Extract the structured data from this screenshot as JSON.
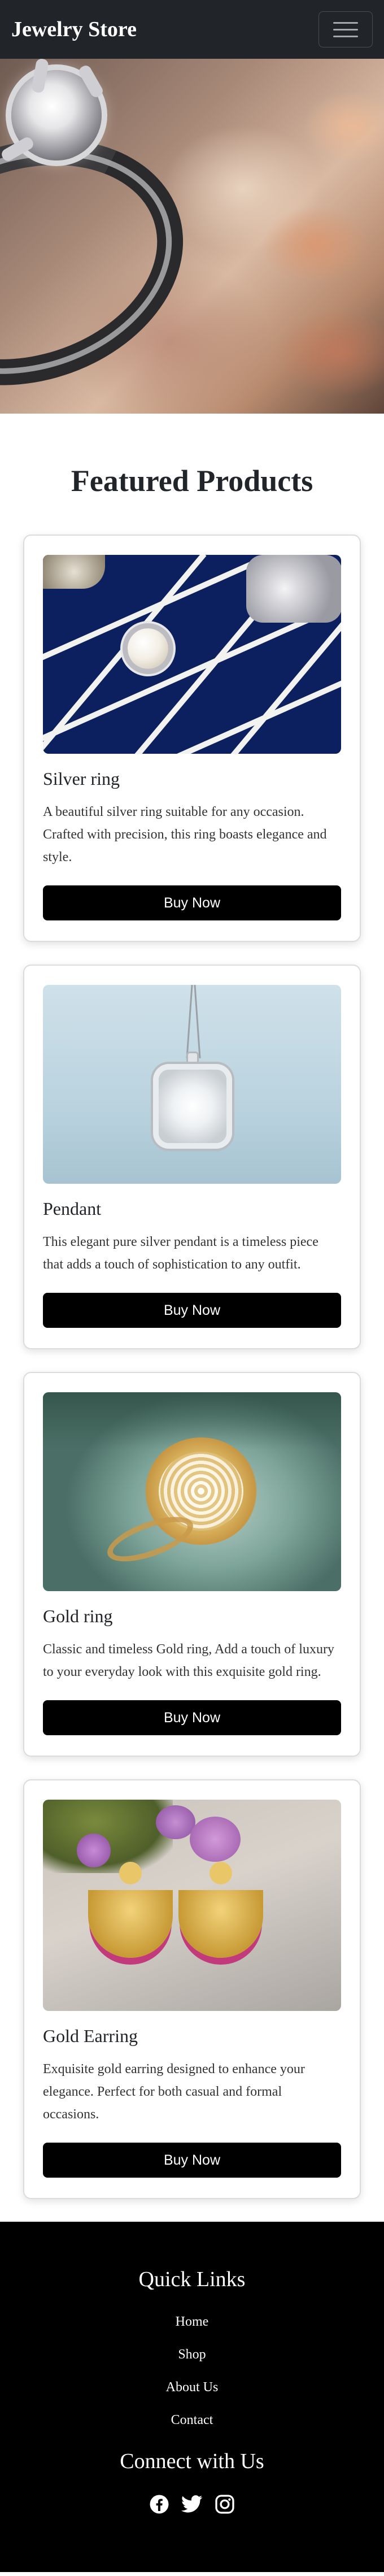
{
  "navbar": {
    "brand": "Jewelry Store",
    "toggler_icon": "hamburger-menu-icon"
  },
  "main": {
    "section_title": "Featured Products"
  },
  "products": [
    {
      "title": "Silver ring",
      "description": "A beautiful silver ring suitable for any occasion. Crafted with precision, this ring boasts elegance and style.",
      "button_label": "Buy Now"
    },
    {
      "title": "Pendant",
      "description": "This elegant pure silver pendant is a timeless piece that adds a touch of sophistication to any outfit.",
      "button_label": "Buy Now"
    },
    {
      "title": "Gold ring",
      "description": "Classic and timeless Gold ring, Add a touch of luxury to your everyday look with this exquisite gold ring.",
      "button_label": "Buy Now"
    },
    {
      "title": "Gold Earring",
      "description": "Exquisite gold earring designed to enhance your elegance. Perfect for both casual and formal occasions.",
      "button_label": "Buy Now"
    }
  ],
  "footer": {
    "quick_links_title": "Quick Links",
    "links": [
      "Home",
      "Shop",
      "About Us",
      "Contact"
    ],
    "connect_title": "Connect with Us",
    "social_icons": [
      "facebook-icon",
      "twitter-icon",
      "instagram-icon"
    ]
  },
  "colors": {
    "navbar_bg": "#212529",
    "button_bg": "#000000",
    "footer_bg": "#000000"
  }
}
